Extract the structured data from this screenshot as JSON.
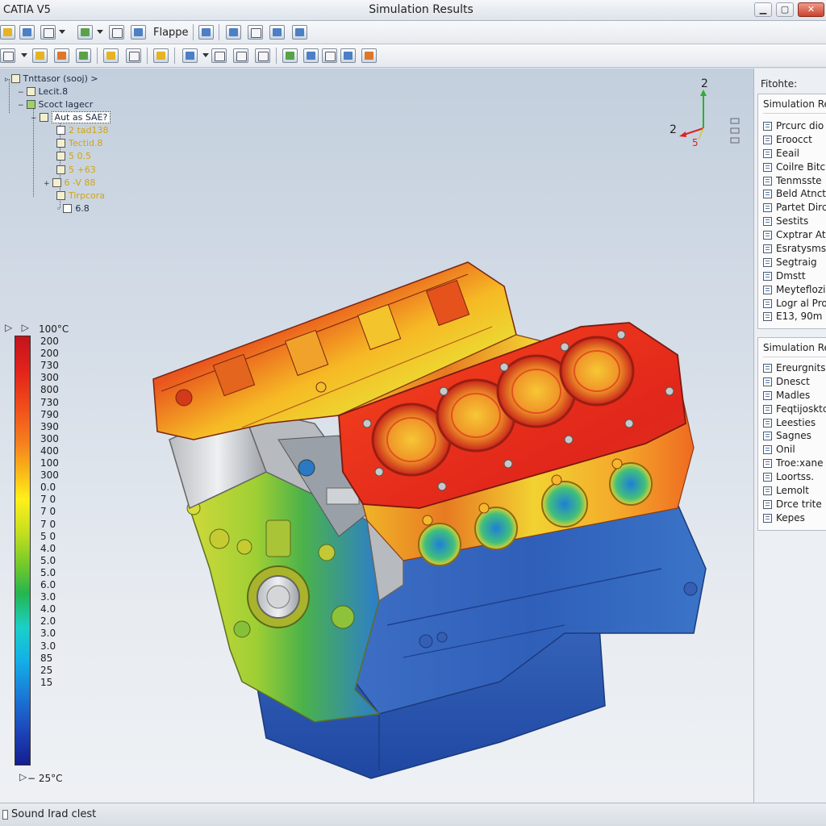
{
  "window": {
    "app_title": "CATIA V5",
    "title": "Simulation Results",
    "minimize": "▁",
    "maximize": "▢",
    "close": "✕"
  },
  "toolbar1": {
    "label": "Flappe"
  },
  "tree": {
    "root": "Tnttasor (sooj) >",
    "items": [
      "Lecit.8",
      "Scoct lagecr",
      "Aut as SAE?",
      "2 tad138",
      "Tectid.8",
      "5 0.5",
      "5 +63",
      "6 -V 88",
      "Tirpcora",
      "6.8"
    ]
  },
  "legend": {
    "top": "100°C",
    "ticks": [
      "200",
      "200",
      "730",
      "300",
      "800",
      "730",
      "790",
      "390",
      "300",
      "400",
      "100",
      "300",
      "0.0",
      "7 0",
      "7 0",
      "7 0",
      "5 0",
      "4.0",
      "5.0",
      "5.0",
      "6.0",
      "3.0",
      "4.0",
      "2.0",
      "3.0",
      "3.0",
      "85",
      "25",
      "15"
    ],
    "bottom": "− 25°C",
    "colors": [
      "#c3141b",
      "#f6801e",
      "#fff01a",
      "#6cc72d",
      "#1ad0c8",
      "#1a79d6",
      "#151e8f"
    ]
  },
  "triad": {
    "y": "2",
    "x": "2",
    "z": "5"
  },
  "right_panel": {
    "header": "Fitohte:",
    "box1": {
      "title": "Simulation Results",
      "items": [
        "Prcurc dio",
        "Eroocct",
        "Eeail",
        "Coilre Bitc",
        "Tenmsste",
        "Beld Atnct",
        "Partet Dirc",
        "Sestits",
        "Cxptrar At",
        "Esratysms",
        "Segtraig",
        "Dmstt",
        "Meyteflozi",
        "Logr al Pro",
        "E13, 90m"
      ]
    },
    "box2": {
      "title": "Simulation Results",
      "items": [
        "Ereurgnits",
        "Dnesct",
        "Madles",
        "Feqtijosktc",
        "Leesties",
        "Sagnes",
        "Onil",
        "Troe:xane",
        "Loortss.",
        "Lemolt",
        "Drce trite",
        "Kepes"
      ]
    }
  },
  "status": {
    "text": "Sound Irad clest"
  }
}
